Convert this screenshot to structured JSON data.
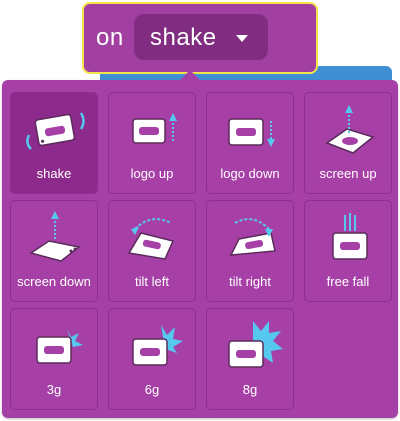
{
  "block": {
    "on_label": "on",
    "selected_value": "shake"
  },
  "options": [
    {
      "label": "shake",
      "icon": "shake-icon",
      "selected": true
    },
    {
      "label": "logo up",
      "icon": "logo-up-icon"
    },
    {
      "label": "logo down",
      "icon": "logo-down-icon"
    },
    {
      "label": "screen up",
      "icon": "screen-up-icon"
    },
    {
      "label": "screen down",
      "icon": "screen-down-icon"
    },
    {
      "label": "tilt left",
      "icon": "tilt-left-icon"
    },
    {
      "label": "tilt right",
      "icon": "tilt-right-icon"
    },
    {
      "label": "free fall",
      "icon": "free-fall-icon"
    },
    {
      "label": "3g",
      "icon": "3g-icon"
    },
    {
      "label": "6g",
      "icon": "6g-icon"
    },
    {
      "label": "8g",
      "icon": "8g-icon"
    }
  ],
  "colors": {
    "block": "#a140a0",
    "outline": "#f2e34a",
    "accent": "#56c8ef",
    "next_block": "#3f8fd4"
  }
}
